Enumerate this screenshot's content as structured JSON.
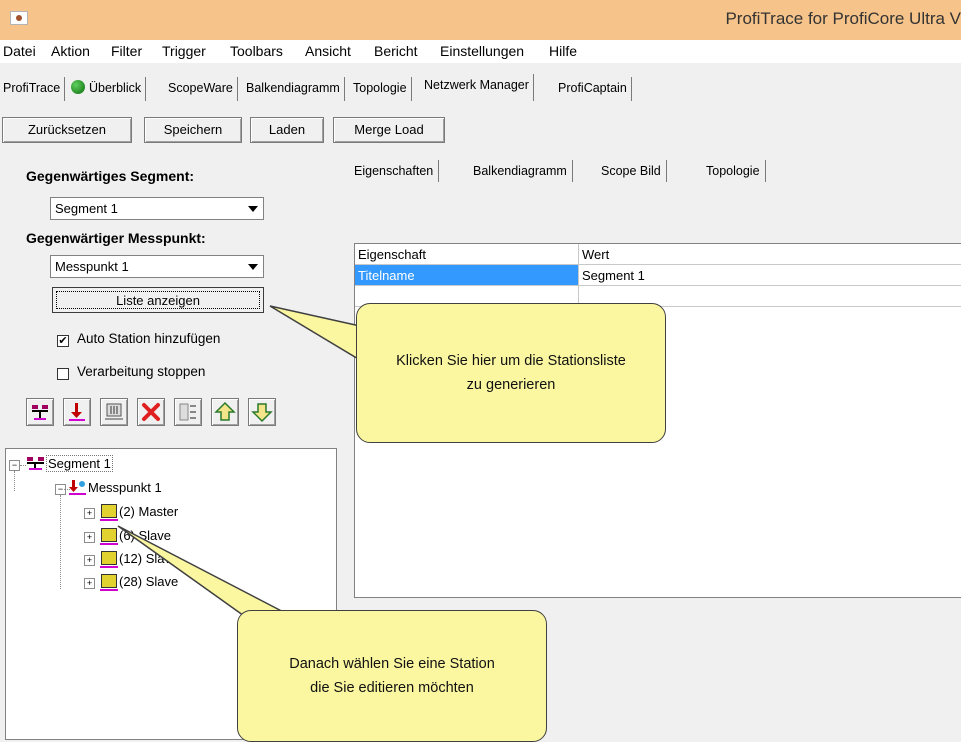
{
  "window": {
    "title": "ProfiTrace for ProfiCore Ultra V"
  },
  "menu": [
    "Datei",
    "Aktion",
    "Filter",
    "Trigger",
    "Toolbars",
    "Ansicht",
    "Bericht",
    "Einstellungen",
    "Hilfe"
  ],
  "main_tabs": [
    "ProfiTrace",
    "Überblick",
    "ScopeWare",
    "Balkendiagramm",
    "Topologie",
    "Netzwerk Manager",
    "ProfiCaptain"
  ],
  "toolbar": {
    "reset": "Zurücksetzen",
    "save": "Speichern",
    "load": "Laden",
    "merge": "Merge Load"
  },
  "left": {
    "segment_label": "Gegenwärtiges Segment:",
    "segment_value": "Segment 1",
    "messpunkt_label": "Gegenwärtiger Messpunkt:",
    "messpunkt_value": "Messpunkt 1",
    "list_button": "Liste anzeigen",
    "auto_station": "Auto Station hinzufügen",
    "auto_station_checked": true,
    "stop_processing": "Verarbeitung stoppen",
    "stop_processing_checked": false,
    "icons": [
      "add-segment-icon",
      "add-measurement-point-icon",
      "add-station-icon",
      "delete-icon",
      "properties-icon",
      "move-up-icon",
      "move-down-icon"
    ]
  },
  "tree": {
    "segment": "Segment 1",
    "messpunkt": "Messpunkt 1",
    "stations": [
      "(2) Master",
      "(6) Slave",
      "(12) Slave",
      "(28) Slave"
    ]
  },
  "right": {
    "tabs": [
      "Eigenschaften",
      "Balkendiagramm",
      "Scope Bild",
      "Topologie"
    ],
    "grid": {
      "col_property": "Eigenschaft",
      "col_value": "Wert",
      "rows": [
        {
          "property": "Titelname",
          "value": "Segment 1"
        }
      ]
    }
  },
  "callouts": {
    "list_hint": "Klicken Sie hier um die Stationsliste zu generieren",
    "station_hint": "Danach wählen Sie eine Station die Sie editieren möchten"
  },
  "colors": {
    "title_bar": "#f6c48a",
    "callout": "#fbf7a1",
    "selection": "#3399ff"
  }
}
